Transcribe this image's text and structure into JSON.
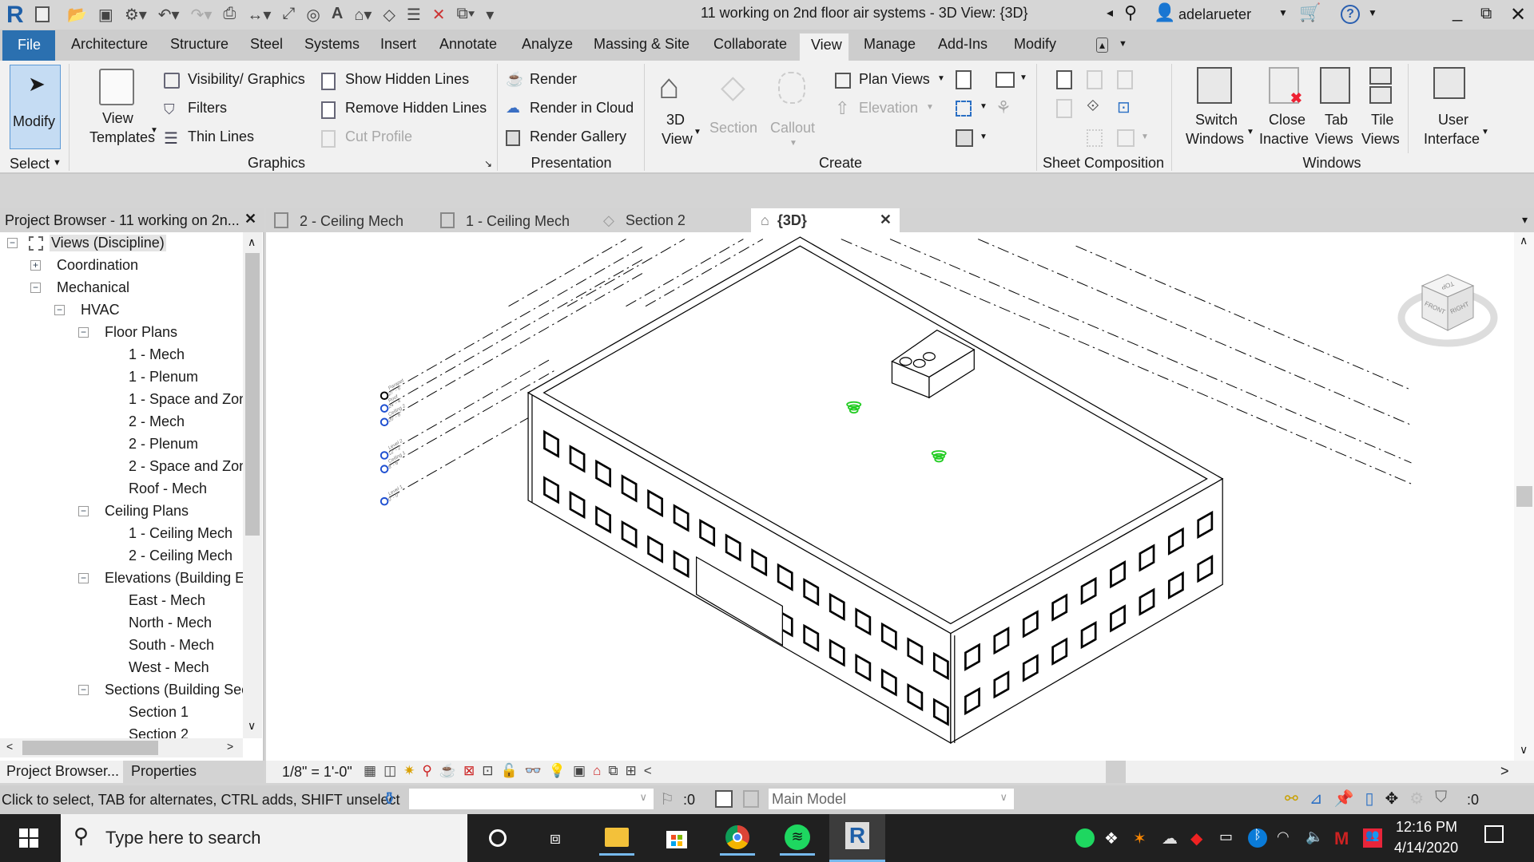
{
  "title_bar": {
    "title": "11 working on 2nd floor air systems - 3D View: {3D}",
    "user": "adelarueter",
    "app_icon": "revit-logo",
    "quick_access_icons": [
      "open-icon",
      "save-icon",
      "sync-icon",
      "undo-icon",
      "redo-icon",
      "print-icon",
      "measure-icon",
      "aligned-dimension-icon",
      "tag-icon",
      "text-icon",
      "3d-view-icon",
      "section-icon",
      "thin-lines-icon",
      "close-hidden-windows-icon",
      "switch-windows-icon",
      "customize-icon"
    ]
  },
  "menu_tabs": [
    {
      "label": "File"
    },
    {
      "label": "Architecture"
    },
    {
      "label": "Structure"
    },
    {
      "label": "Steel"
    },
    {
      "label": "Systems"
    },
    {
      "label": "Insert"
    },
    {
      "label": "Annotate"
    },
    {
      "label": "Analyze"
    },
    {
      "label": "Massing & Site"
    },
    {
      "label": "Collaborate"
    },
    {
      "label": "View",
      "active": true
    },
    {
      "label": "Manage"
    },
    {
      "label": "Add-Ins"
    },
    {
      "label": "Modify"
    }
  ],
  "ribbon": {
    "select": {
      "modify": "Modify",
      "panel": "Select"
    },
    "graphics": {
      "panel": "Graphics",
      "view_templates_1": "View",
      "view_templates_2": "Templates",
      "visibility": "Visibility/ Graphics",
      "filters": "Filters",
      "thin_lines": "Thin  Lines",
      "show_hidden": "Show  Hidden Lines",
      "remove_hidden": "Remove  Hidden Lines",
      "cut_profile": "Cut  Profile"
    },
    "presentation": {
      "panel": "Presentation",
      "render": "Render",
      "render_cloud": "Render  in Cloud",
      "render_gallery": "Render  Gallery"
    },
    "create": {
      "panel": "Create",
      "view3d_1": "3D",
      "view3d_2": "View",
      "section": "Section",
      "callout": "Callout",
      "plan_views": "Plan  Views",
      "elevation": "Elevation"
    },
    "sheet": {
      "panel": "Sheet Composition"
    },
    "windows": {
      "panel": "Windows",
      "switch_1": "Switch",
      "switch_2": "Windows",
      "close_1": "Close",
      "close_2": "Inactive",
      "tab_1": "Tab",
      "tab_2": "Views",
      "tile_1": "Tile",
      "tile_2": "Views",
      "ui_1": "User",
      "ui_2": "Interface"
    }
  },
  "project_browser": {
    "title": "Project Browser - 11 working on 2n...",
    "tree": [
      {
        "label": "Views (Discipline)",
        "level": 0,
        "expander": "minus",
        "selected": true
      },
      {
        "label": "Coordination",
        "level": 1,
        "expander": "plus"
      },
      {
        "label": "Mechanical",
        "level": 1,
        "expander": "minus"
      },
      {
        "label": "HVAC",
        "level": 2,
        "expander": "minus"
      },
      {
        "label": "Floor Plans",
        "level": 3,
        "expander": "minus"
      },
      {
        "label": "1 - Mech",
        "level": 4
      },
      {
        "label": "1 - Plenum",
        "level": 4
      },
      {
        "label": "1 - Space and Zon",
        "level": 4
      },
      {
        "label": "2 - Mech",
        "level": 4
      },
      {
        "label": "2 - Plenum",
        "level": 4
      },
      {
        "label": "2 - Space and Zon",
        "level": 4
      },
      {
        "label": "Roof - Mech",
        "level": 4
      },
      {
        "label": "Ceiling Plans",
        "level": 3,
        "expander": "minus"
      },
      {
        "label": "1 - Ceiling Mech",
        "level": 4
      },
      {
        "label": "2 - Ceiling Mech",
        "level": 4
      },
      {
        "label": "Elevations (Building El",
        "level": 3,
        "expander": "minus"
      },
      {
        "label": "East - Mech",
        "level": 4
      },
      {
        "label": "North - Mech",
        "level": 4
      },
      {
        "label": "South - Mech",
        "level": 4
      },
      {
        "label": "West - Mech",
        "level": 4
      },
      {
        "label": "Sections (Building Sec",
        "level": 3,
        "expander": "minus"
      },
      {
        "label": "Section 1",
        "level": 4
      },
      {
        "label": "Section 2",
        "level": 4
      }
    ],
    "bottom_tabs": [
      {
        "label": "Project Browser..."
      },
      {
        "label": "Properties"
      }
    ]
  },
  "doc_tabs": [
    {
      "label": "2 - Ceiling Mech",
      "icon": "ceiling-plan-icon"
    },
    {
      "label": "1 - Ceiling Mech",
      "icon": "ceiling-plan-icon"
    },
    {
      "label": "Section 2",
      "icon": "section-icon"
    },
    {
      "label": "{3D}",
      "icon": "3d-view-icon",
      "active": true
    }
  ],
  "viewport": {
    "levels": [
      {
        "name": "Parapet",
        "elev": "27' - 6\""
      },
      {
        "name": "Roof",
        "elev": "24' - 4\""
      },
      {
        "name": "Ceiling 2",
        "elev": "20' - 8\""
      },
      {
        "name": "Level 2",
        "elev": "12' - 2\""
      },
      {
        "name": "Ceiling 1",
        "elev": "8' - 6\""
      },
      {
        "name": "Level 1",
        "elev": "0' - 0\""
      }
    ],
    "viewcube": {
      "top": "TOP",
      "front": "FRONT",
      "right": "RIGHT"
    },
    "diffuser_color": "#22cc22"
  },
  "view_control_bar": {
    "scale": "1/8\" = 1'-0\""
  },
  "status_bar": {
    "hint": "Click to select, TAB for alternates, CTRL adds, SHIFT unselect",
    "workset_count": ":0",
    "model": "Main Model",
    "filter_count": ":0"
  },
  "taskbar": {
    "search_placeholder": "Type here to search",
    "time": "12:16 PM",
    "date": "4/14/2020",
    "apps": [
      "cortana",
      "task-view",
      "file-explorer",
      "microsoft-store",
      "chrome",
      "spotify",
      "revit"
    ]
  },
  "colors": {
    "file_tab": "#2b70b0",
    "accent": "#1e5fa8",
    "modify_bg": "#c5dcf3"
  }
}
